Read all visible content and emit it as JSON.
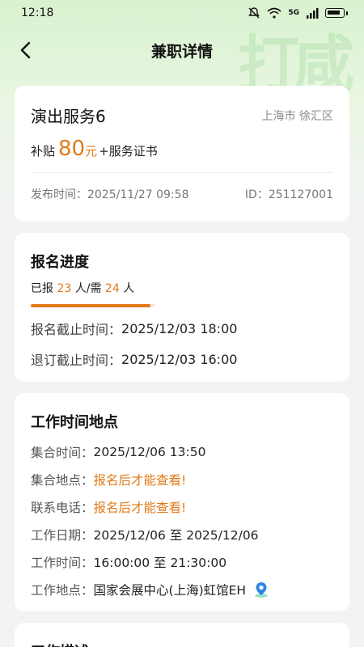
{
  "status_bar": {
    "time": "12:18",
    "icons": [
      "mute-icon",
      "wifi-icon",
      "5g-signal-icon",
      "battery-icon"
    ],
    "network": "5G"
  },
  "nav": {
    "title": "兼职详情",
    "back_icon": "chevron-left-icon"
  },
  "header_decoration": "打咸",
  "job": {
    "title": "演出服务6",
    "location": "上海市 徐汇区",
    "pay_prefix": "补贴",
    "pay_amount": "80",
    "pay_unit": "元",
    "pay_extra": "+服务证书",
    "publish_time": "发布时间：2025/11/27 09:58",
    "id": "ID：251127001"
  },
  "signup": {
    "title": "报名进度",
    "progress_label_a": "已报",
    "signed": "23",
    "progress_label_b": "人/需",
    "needed": "24",
    "progress_label_c": "人",
    "progress_fraction": 0.958,
    "deadline_label": "报名截止时间：",
    "deadline_value": "2025/12/03 18:00",
    "cancel_label": "退订截止时间：",
    "cancel_value": "2025/12/03 16:00"
  },
  "work": {
    "title": "工作时间地点",
    "rows": [
      {
        "label": "集合时间：",
        "value": "2025/12/06 13:50"
      },
      {
        "label": "集合地点：",
        "value": "报名后才能查看!"
      },
      {
        "label": "联系电话：",
        "value": "报名后才能查看!"
      },
      {
        "label": "工作日期：",
        "value": "2025/12/06 至 2025/12/06"
      },
      {
        "label": "工作时间：",
        "value": "16:00:00 至 21:30:00"
      },
      {
        "label": "工作地点：",
        "value": "国家会展中心(上海)虹馆EH"
      }
    ],
    "location_icon": "map-pin-icon"
  },
  "description": {
    "title": "工作描述"
  },
  "colors": {
    "accent": "#e17b17",
    "header_green": "#d9f2cf",
    "page_bg": "#f2f3f5"
  }
}
